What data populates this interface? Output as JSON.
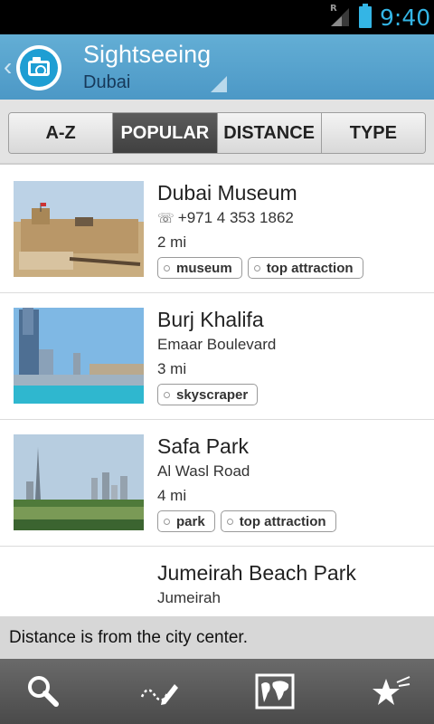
{
  "status_bar": {
    "time": "9:40",
    "signal_label": "R"
  },
  "action_bar": {
    "title": "Sightseeing",
    "subtitle": "Dubai"
  },
  "tabs": [
    {
      "label": "A-Z",
      "active": false
    },
    {
      "label": "POPULAR",
      "active": true
    },
    {
      "label": "DISTANCE",
      "active": false
    },
    {
      "label": "TYPE",
      "active": false
    }
  ],
  "places": [
    {
      "name": "Dubai Museum",
      "phone_icon": "☏",
      "detail": "+971 4 353 1862",
      "distance": "2 mi",
      "tags": [
        "museum",
        "top attraction"
      ]
    },
    {
      "name": "Burj Khalifa",
      "detail": "Emaar Boulevard",
      "distance": "3 mi",
      "tags": [
        "skyscraper"
      ]
    },
    {
      "name": "Safa Park",
      "detail": "Al Wasl Road",
      "distance": "4 mi",
      "tags": [
        "park",
        "top attraction"
      ]
    },
    {
      "name": "Jumeirah Beach Park",
      "detail": "Jumeirah",
      "distance": "",
      "tags": []
    }
  ],
  "footer_note": "Distance is from the city center.",
  "bottom_nav": [
    "search-icon",
    "draw-route-icon",
    "map-icon",
    "favorites-icon"
  ],
  "colors": {
    "accent": "#34b5e5",
    "action_bar": "#5aa6d0",
    "active_tab": "#4a4a4a"
  }
}
